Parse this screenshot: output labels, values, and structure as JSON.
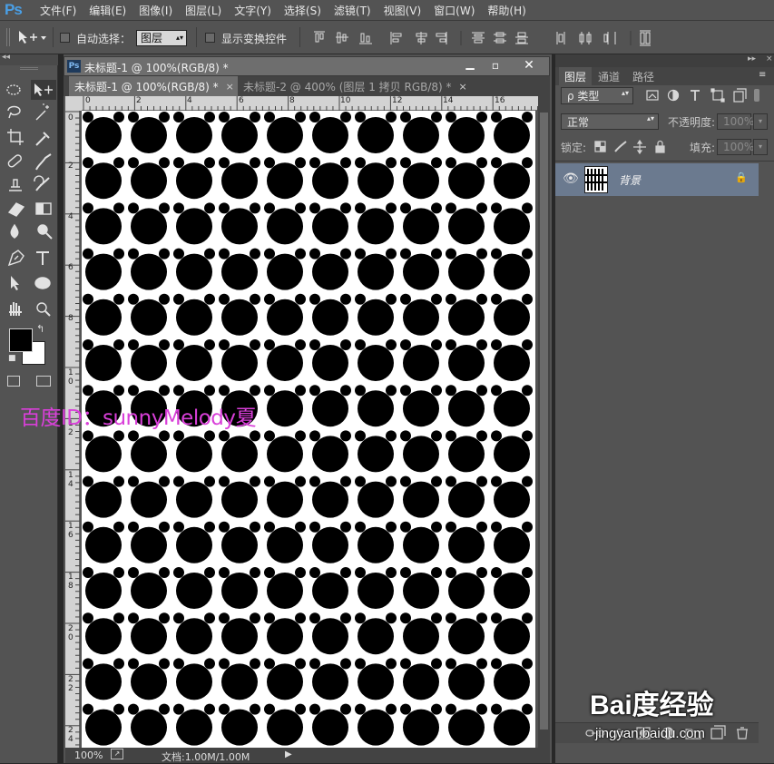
{
  "app": {
    "logo": "Ps",
    "menu": [
      "文件(F)",
      "编辑(E)",
      "图像(I)",
      "图层(L)",
      "文字(Y)",
      "选择(S)",
      "滤镜(T)",
      "视图(V)",
      "窗口(W)",
      "帮助(H)"
    ]
  },
  "options": {
    "auto_select_label": "自动选择：",
    "auto_select_value": "图层",
    "show_transform_label": "显示变换控件"
  },
  "tools": [
    "marquee-tool",
    "move-tool",
    "lasso-tool",
    "magic-wand-tool",
    "crop-tool",
    "eyedropper-tool",
    "healing-brush-tool",
    "brush-tool",
    "clone-stamp-tool",
    "history-brush-tool",
    "eraser-tool",
    "gradient-tool",
    "blur-tool",
    "dodge-tool",
    "pen-tool",
    "type-tool",
    "path-selection-tool",
    "ellipse-tool",
    "hand-tool",
    "zoom-tool"
  ],
  "document": {
    "window_title": "未标题-1 @ 100%(RGB/8) *",
    "tabs": [
      {
        "label": "未标题-1 @ 100%(RGB/8) *",
        "active": true
      },
      {
        "label": "未标题-2 @ 400% (图层 1 拷贝  RGB/8) *",
        "active": false
      }
    ],
    "tab_close": "×",
    "ruler_top": [
      "0",
      "2",
      "4",
      "6",
      "8",
      "10",
      "12",
      "14",
      "16"
    ],
    "ruler_left": [
      "0",
      "2",
      "4",
      "6",
      "8",
      "1 0",
      "1 2",
      "1 4",
      "1 6",
      "1 8",
      "2 0",
      "2 2",
      "2 4"
    ],
    "zoom": "100%",
    "doc_size": "文档:1.00M/1.00M",
    "pattern": {
      "columns": 10,
      "rows": 14,
      "shape": "bear-head",
      "color": "#000000",
      "background": "#ffffff"
    }
  },
  "layers_panel": {
    "tabs": [
      "图层",
      "通道",
      "路径"
    ],
    "filter_label": "ρ 类型",
    "blend_mode": "正常",
    "opacity_label": "不透明度:",
    "opacity_value": "100%",
    "lock_label": "锁定:",
    "fill_label": "填充:",
    "fill_value": "100%",
    "layers": [
      {
        "name": "背景",
        "visible": true,
        "locked": true
      }
    ]
  },
  "watermarks": {
    "baidu_id": "百度ID：sunnyMelody夏",
    "baidu_logo": "Bai度经验",
    "jingyan_url": "jingyan.baidu.com"
  },
  "colors": {
    "chrome": "#535353",
    "layer_selected": "#6b7a8f",
    "ps_blue": "#4a9fe6",
    "watermark_magenta": "#d93fd9"
  }
}
